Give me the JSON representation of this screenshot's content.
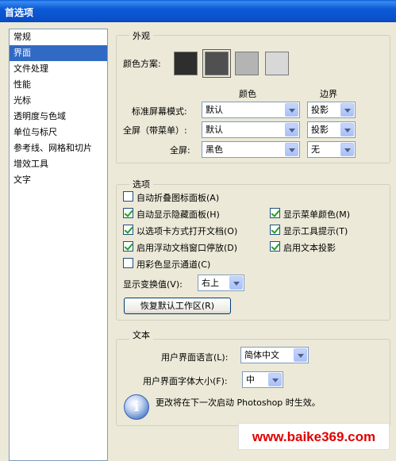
{
  "window": {
    "title": "首选项"
  },
  "sidebar": {
    "items": [
      {
        "label": "常规",
        "selected": false
      },
      {
        "label": "界面",
        "selected": true
      },
      {
        "label": "文件处理",
        "selected": false
      },
      {
        "label": "性能",
        "selected": false
      },
      {
        "label": "光标",
        "selected": false
      },
      {
        "label": "透明度与色域",
        "selected": false
      },
      {
        "label": "单位与标尺",
        "selected": false
      },
      {
        "label": "参考线、网格和切片",
        "selected": false
      },
      {
        "label": "增效工具",
        "selected": false
      },
      {
        "label": "文字",
        "selected": false
      }
    ]
  },
  "appearance": {
    "legend": "外观",
    "color_scheme_label": "颜色方案:",
    "swatches": [
      {
        "color": "#2e2e2e",
        "selected": false
      },
      {
        "color": "#505050",
        "selected": true
      },
      {
        "color": "#b4b4b4",
        "selected": false
      },
      {
        "color": "#d8d8d8",
        "selected": false
      }
    ],
    "col_color_header": "颜色",
    "col_border_header": "边界",
    "rows": [
      {
        "label": "标准屏幕模式:",
        "color_value": "默认",
        "border_value": "投影"
      },
      {
        "label": "全屏（带菜单）:",
        "color_value": "默认",
        "border_value": "投影"
      },
      {
        "label": "全屏:",
        "color_value": "黑色",
        "border_value": "无"
      }
    ]
  },
  "options": {
    "legend": "选项",
    "left_checkboxes": [
      {
        "label": "自动折叠图标面板(A)",
        "checked": false
      },
      {
        "label": "自动显示隐藏面板(H)",
        "checked": true
      },
      {
        "label": "以选项卡方式打开文档(O)",
        "checked": true
      },
      {
        "label": "启用浮动文档窗口停放(D)",
        "checked": true
      },
      {
        "label": "用彩色显示通道(C)",
        "checked": false
      }
    ],
    "right_checkboxes": [
      {
        "label": "显示菜单颜色(M)",
        "checked": true
      },
      {
        "label": "显示工具提示(T)",
        "checked": true
      },
      {
        "label": "启用文本投影",
        "checked": true
      }
    ],
    "transform_label": "显示变换值(V):",
    "transform_value": "右上",
    "reset_button": "恢复默认工作区(R)"
  },
  "text_section": {
    "legend": "文本",
    "ui_language_label": "用户界面语言(L):",
    "ui_language_value": "简体中文",
    "ui_font_size_label": "用户界面字体大小(F):",
    "ui_font_size_value": "中",
    "info_icon_glyph": "i",
    "info_text": "更改将在下一次启动 Photoshop 时生效。"
  },
  "watermark": {
    "text": "www.baike369.com"
  }
}
